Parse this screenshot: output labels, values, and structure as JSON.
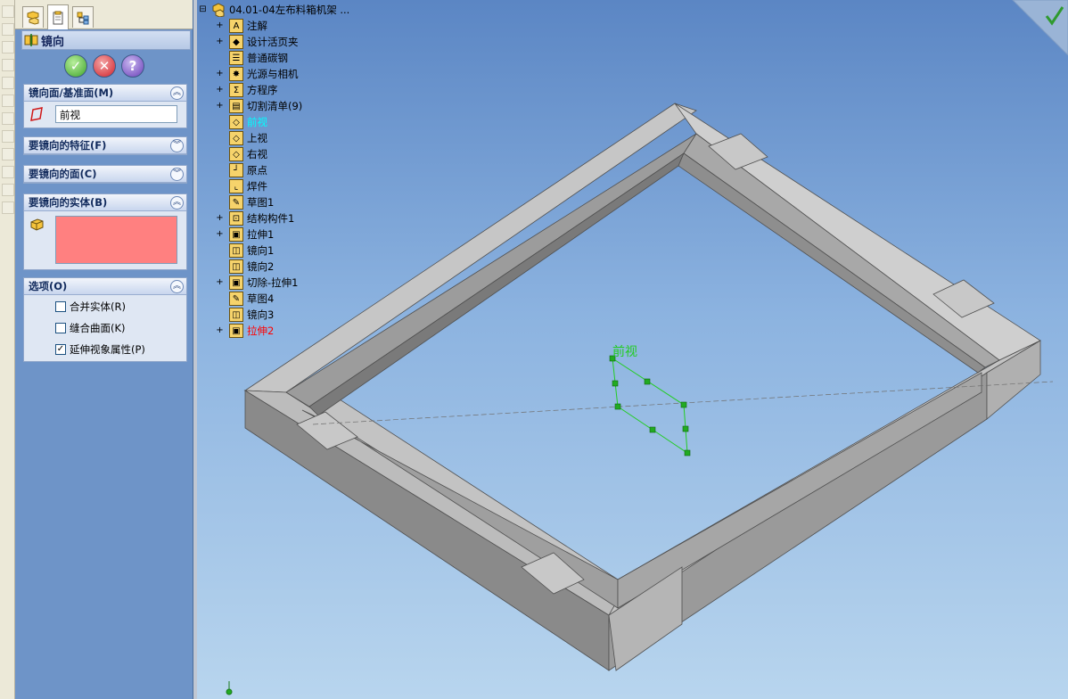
{
  "property_manager": {
    "title": "镜向",
    "sections": {
      "plane": {
        "header": "镜向面/基准面(M)",
        "value": "前视"
      },
      "features": {
        "header": "要镜向的特征(F)"
      },
      "faces": {
        "header": "要镜向的面(C)"
      },
      "bodies": {
        "header": "要镜向的实体(B)"
      },
      "options": {
        "header": "选项(O)",
        "items": [
          {
            "label": "合并实体(R)",
            "checked": false
          },
          {
            "label": "缝合曲面(K)",
            "checked": false
          },
          {
            "label": "延伸视象属性(P)",
            "checked": true
          }
        ]
      }
    },
    "actions": {
      "ok": "✓",
      "cancel": "✕",
      "help": "?"
    }
  },
  "tree": {
    "root": "04.01-04左布料箱机架  ...",
    "items": [
      {
        "label": "注解",
        "expandable": true
      },
      {
        "label": "设计活页夹",
        "expandable": true
      },
      {
        "label": "普通碳钢",
        "expandable": false
      },
      {
        "label": "光源与相机",
        "expandable": true
      },
      {
        "label": "方程序",
        "expandable": true
      },
      {
        "label": "切割清单(9)",
        "expandable": true
      },
      {
        "label": "前视",
        "expandable": false,
        "state": "selected"
      },
      {
        "label": "上视",
        "expandable": false
      },
      {
        "label": "右视",
        "expandable": false
      },
      {
        "label": "原点",
        "expandable": false
      },
      {
        "label": "焊件",
        "expandable": false
      },
      {
        "label": "草图1",
        "expandable": false
      },
      {
        "label": "结构构件1",
        "expandable": true
      },
      {
        "label": "拉伸1",
        "expandable": true
      },
      {
        "label": "镜向1",
        "expandable": false
      },
      {
        "label": "镜向2",
        "expandable": false
      },
      {
        "label": "切除-拉伸1",
        "expandable": true
      },
      {
        "label": "草图4",
        "expandable": false
      },
      {
        "label": "镜向3",
        "expandable": false
      },
      {
        "label": "拉伸2",
        "expandable": true,
        "state": "red"
      }
    ]
  },
  "viewport": {
    "plane_label": "前视",
    "colors": {
      "plane": "#22cc22",
      "selected": "#00ffff",
      "error": "#ff0000",
      "bodies_fill": "#ff8080"
    }
  }
}
